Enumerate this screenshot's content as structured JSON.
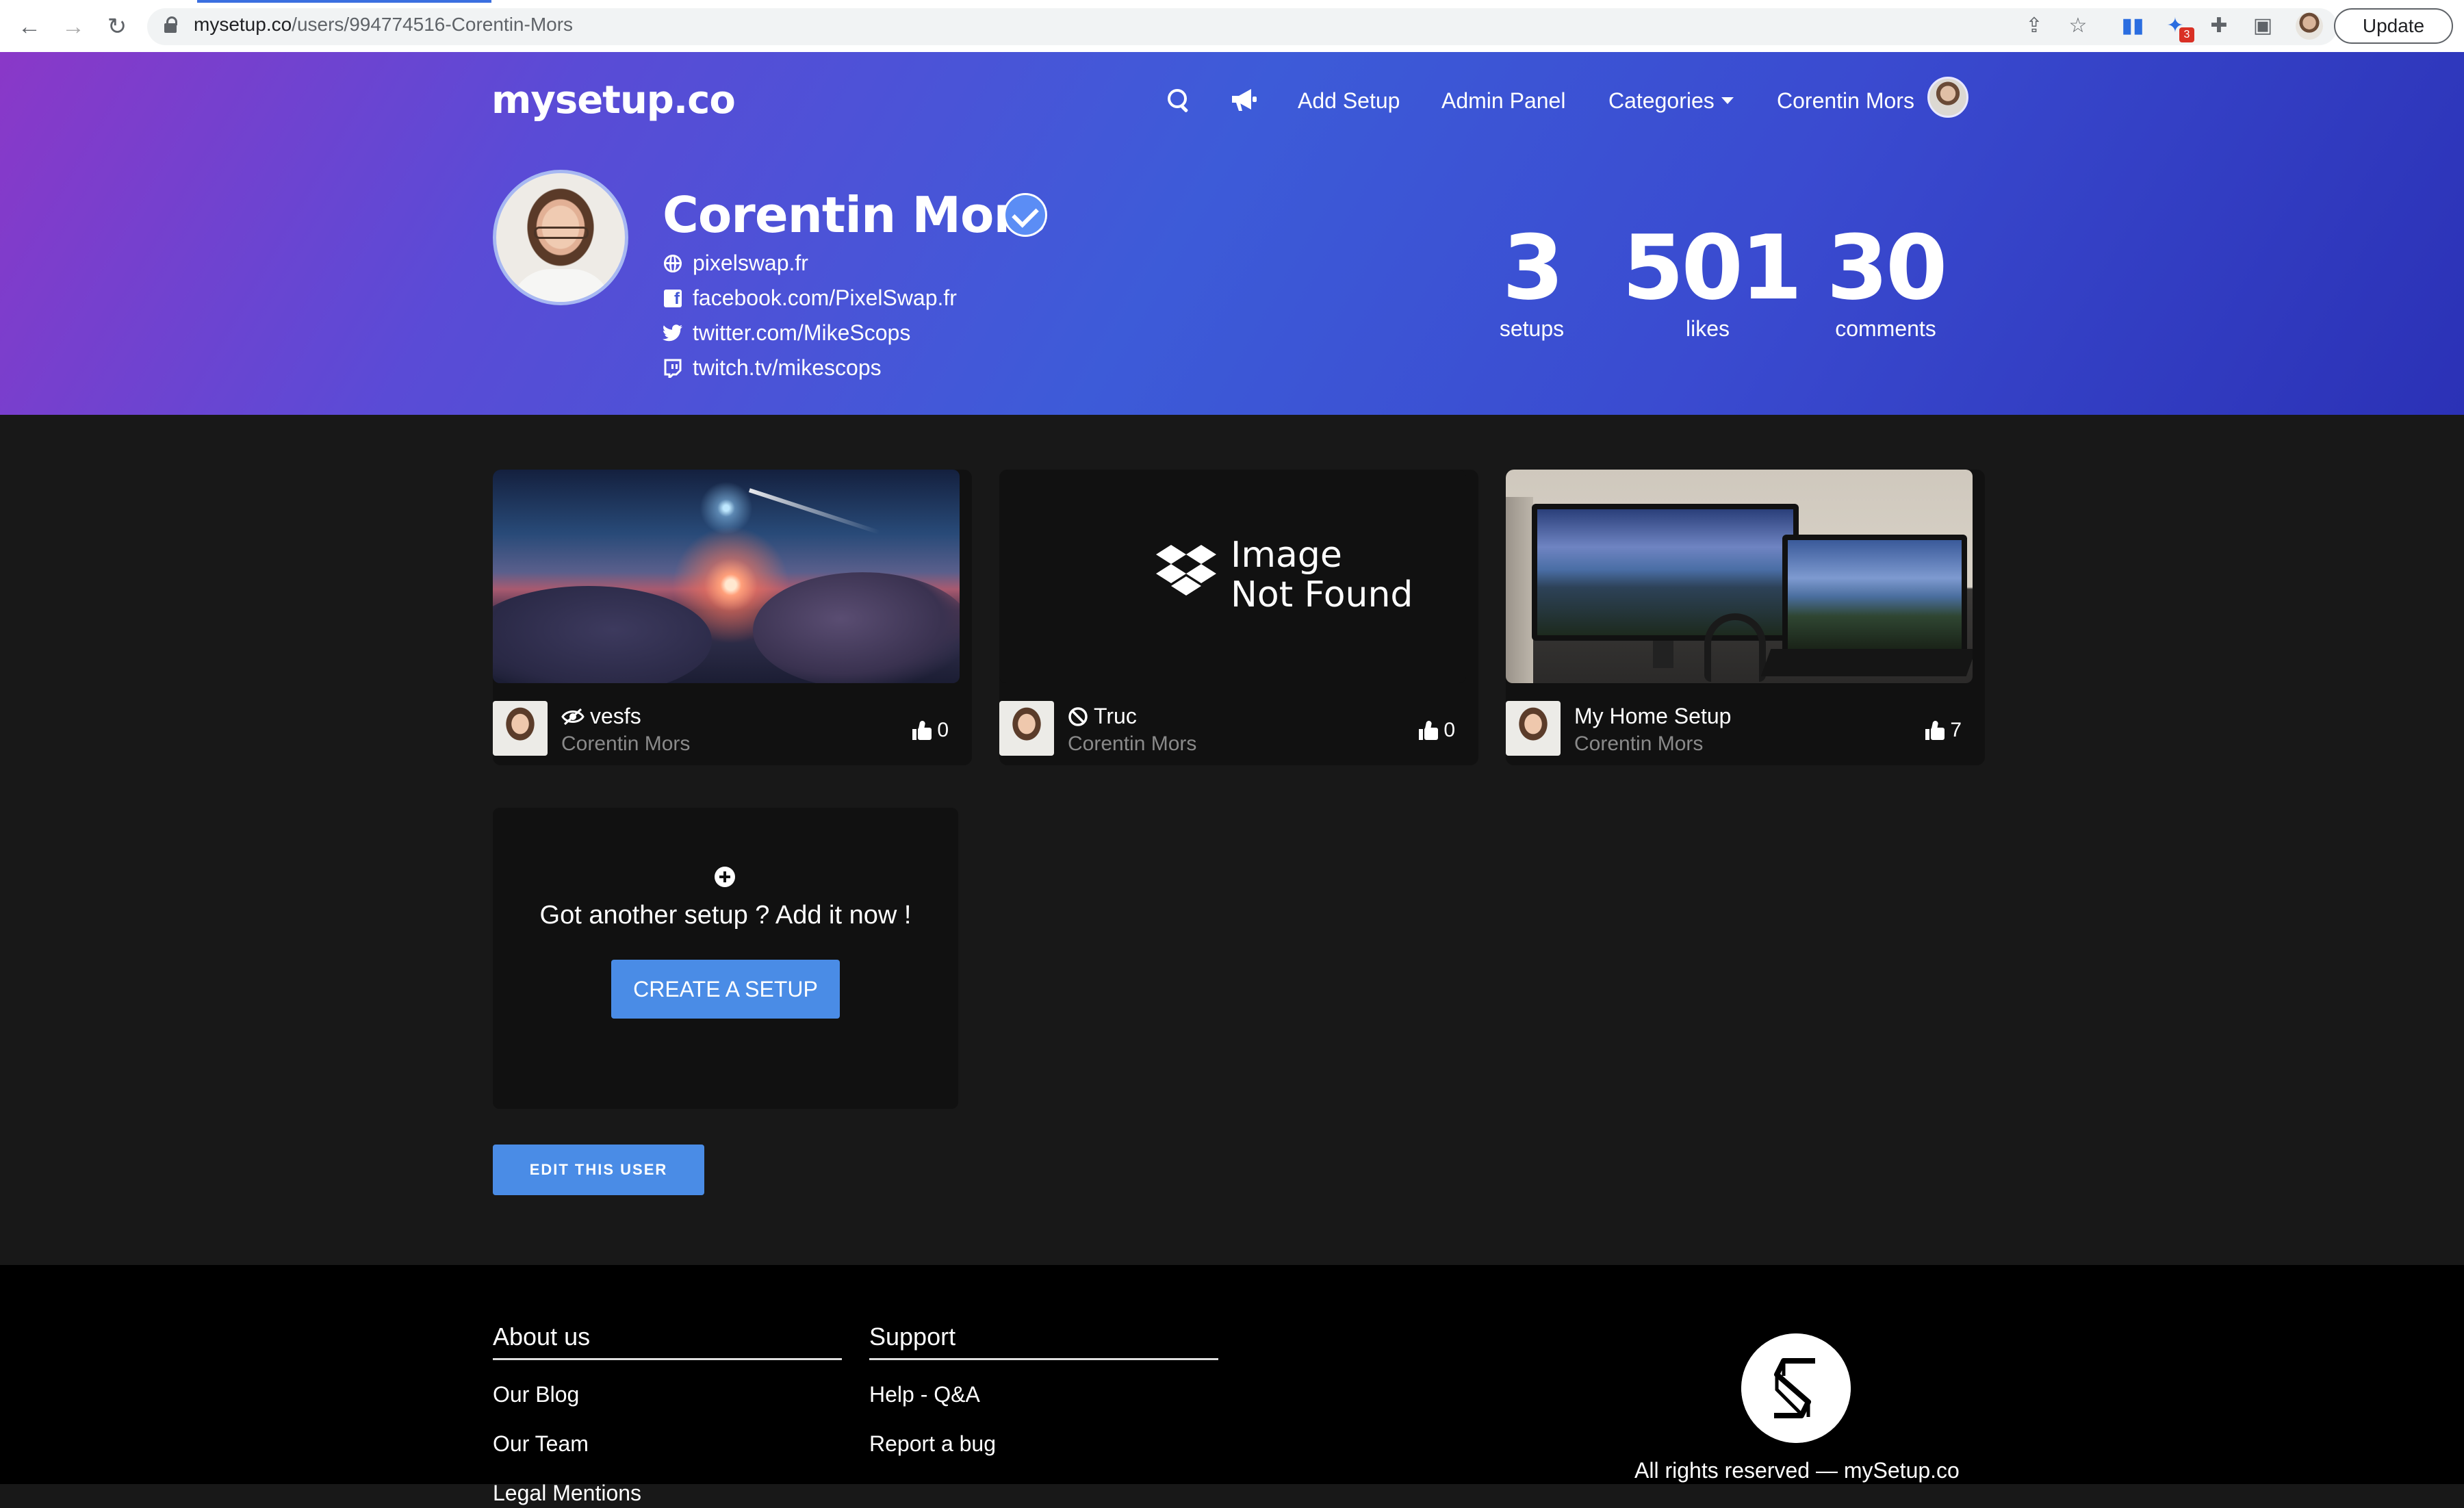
{
  "browser": {
    "url_domain": "mysetup.co",
    "url_path": "/users/994774516-Corentin-Mors",
    "update_label": "Update",
    "extension_badge": "3"
  },
  "header": {
    "logo": "mysetup.co",
    "nav": {
      "add_setup": "Add Setup",
      "admin_panel": "Admin Panel",
      "categories": "Categories",
      "user_name": "Corentin Mors"
    }
  },
  "profile": {
    "name": "Corentin Mors",
    "links": {
      "website": "pixelswap.fr",
      "facebook": "facebook.com/PixelSwap.fr",
      "twitter": "twitter.com/MikeScops",
      "twitch": "twitch.tv/mikescops"
    },
    "stats": [
      {
        "value": "3",
        "label": "setups"
      },
      {
        "value": "501",
        "label": "likes"
      },
      {
        "value": "30",
        "label": "comments"
      }
    ]
  },
  "setups": [
    {
      "title": "vesfs",
      "owner": "Corentin Mors",
      "likes": "0",
      "status_icon": "hidden-eye-icon"
    },
    {
      "title": "Truc",
      "owner": "Corentin Mors",
      "likes": "0",
      "status_icon": "ban-icon",
      "image_text_line1": "Image",
      "image_text_line2": "Not Found"
    },
    {
      "title": "My Home Setup",
      "owner": "Corentin Mors",
      "likes": "7"
    }
  ],
  "add_setup": {
    "prompt": "Got another setup ? Add it now !",
    "button": "CREATE A SETUP"
  },
  "edit_user_button": "EDIT THIS USER",
  "footer": {
    "about": {
      "heading": "About us",
      "links": [
        "Our Blog",
        "Our Team",
        "Legal Mentions"
      ]
    },
    "support": {
      "heading": "Support",
      "links": [
        "Help - Q&A",
        "Report a bug"
      ]
    },
    "copyright": "All rights reserved — mySetup.co"
  },
  "colors": {
    "accent": "#4a8ce6",
    "verified": "#5b8df5",
    "hero_gradient_start": "#8a38c8",
    "hero_gradient_end": "#2b31b6"
  }
}
